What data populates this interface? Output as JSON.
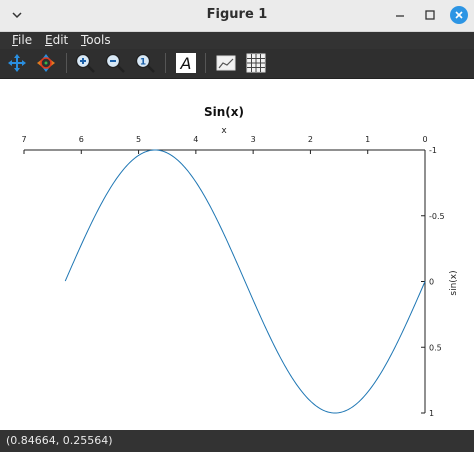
{
  "window": {
    "title": "Figure 1"
  },
  "menu": {
    "file": "File",
    "edit": "Edit",
    "tools": "Tools"
  },
  "toolbar": {
    "icons": [
      "pan-icon",
      "rotate-icon",
      "zoom-in-icon",
      "zoom-out-icon",
      "zoom-reset-icon",
      "text-icon",
      "axes-icon",
      "grid-icon"
    ]
  },
  "status": {
    "coords": "(0.84664, 0.25564)"
  },
  "chart_data": {
    "type": "line",
    "title": "Sin(x)",
    "xlabel": "x",
    "ylabel": "sin(x)",
    "xlim": [
      7,
      0
    ],
    "ylim": [
      -1,
      1
    ],
    "x_reversed": true,
    "y_reversed": true,
    "x_axis_location": "top",
    "y_axis_location": "right",
    "xticks": [
      "7",
      "6",
      "5",
      "4",
      "3",
      "2",
      "1",
      "0"
    ],
    "yticks": [
      "-1",
      "-0.5",
      "0",
      "0.5",
      "1"
    ],
    "grid": false,
    "series": [
      {
        "color": "#1f77b4",
        "function": "sin(x)",
        "x_range": [
          0,
          6.28
        ]
      }
    ]
  }
}
